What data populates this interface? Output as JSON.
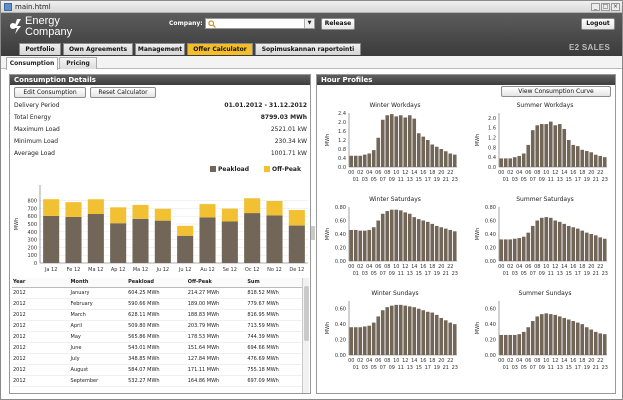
{
  "window": {
    "title": "main.html"
  },
  "header": {
    "logo_line1": "Energy",
    "logo_line2": "Company",
    "company_label": "Company:",
    "company_value": "",
    "release_label": "Release",
    "logout_label": "Logout",
    "product_name": "E2 SALES",
    "nav_tabs": [
      {
        "label": "Portfolio",
        "active": false
      },
      {
        "label": "Own Agreements",
        "active": false
      },
      {
        "label": "Management",
        "active": false
      },
      {
        "label": "Offer Calculator",
        "active": true
      },
      {
        "label": "Sopimuskannan raportointi",
        "active": false
      }
    ]
  },
  "subtabs": [
    {
      "label": "Consumption",
      "active": true
    },
    {
      "label": "Pricing",
      "active": false
    }
  ],
  "consumption": {
    "title": "Consumption Details",
    "edit_label": "Edit Consumption",
    "reset_label": "Reset Calculator",
    "info": [
      {
        "label": "Delivery Period",
        "value": "01.01.2012 - 31.12.2012"
      },
      {
        "label": "Total Energy",
        "value": "8799.03 MWh"
      },
      {
        "label": "Maximum Load",
        "value": "2521.01 kW"
      },
      {
        "label": "Minimum Load",
        "value": "230.34 kW"
      },
      {
        "label": "Average Load",
        "value": "1001.71 kW"
      }
    ],
    "legend": {
      "peak": "Peakload",
      "offpeak": "Off-Peak"
    },
    "table": {
      "columns": [
        "Year",
        "Month",
        "Peakload",
        "Off-Peak",
        "Sum"
      ],
      "rows": [
        [
          "2012",
          "January",
          "604.25 MWh",
          "214.27 MWh",
          "818.52 MWh"
        ],
        [
          "2012",
          "February",
          "590.66 MWh",
          "189.00 MWh",
          "779.67 MWh"
        ],
        [
          "2012",
          "March",
          "628.11 MWh",
          "188.83 MWh",
          "816.95 MWh"
        ],
        [
          "2012",
          "April",
          "509.80 MWh",
          "203.79 MWh",
          "713.59 MWh"
        ],
        [
          "2012",
          "May",
          "565.86 MWh",
          "178.53 MWh",
          "744.39 MWh"
        ],
        [
          "2012",
          "June",
          "543.01 MWh",
          "151.64 MWh",
          "694.66 MWh"
        ],
        [
          "2012",
          "July",
          "348.85 MWh",
          "127.84 MWh",
          "476.69 MWh"
        ],
        [
          "2012",
          "August",
          "584.07 MWh",
          "171.11 MWh",
          "755.18 MWh"
        ],
        [
          "2012",
          "September",
          "532.27 MWh",
          "164.86 MWh",
          "697.09 MWh"
        ]
      ]
    }
  },
  "hour_profiles": {
    "title": "Hour Profiles",
    "view_label": "View Consumption Curve"
  },
  "colors": {
    "peak": "#716658",
    "offpeak": "#f1c033",
    "accent": "#f3be29"
  },
  "chart_data": [
    {
      "type": "bar",
      "stacked": true,
      "title": "",
      "ylabel": "MWh",
      "categories": [
        "Ja 12",
        "Fe 12",
        "Ma 12",
        "Ap 12",
        "Ma 12",
        "Ju 12",
        "Ju 12",
        "Au 12",
        "Se 12",
        "Oc 12",
        "No 12",
        "De 12"
      ],
      "series": [
        {
          "name": "Peakload",
          "values": [
            604,
            591,
            628,
            510,
            566,
            543,
            349,
            584,
            532,
            640,
            610,
            480
          ]
        },
        {
          "name": "Off-Peak",
          "values": [
            214,
            189,
            189,
            204,
            179,
            152,
            128,
            171,
            165,
            190,
            185,
            200
          ]
        }
      ],
      "ylim": [
        0,
        1000
      ],
      "yticks": [
        0,
        100,
        200,
        300,
        400,
        500,
        600,
        700,
        800
      ]
    },
    {
      "type": "bar",
      "title": "Winter Workdays",
      "ylabel": "MWh",
      "x": [
        0,
        1,
        2,
        3,
        4,
        5,
        6,
        7,
        8,
        9,
        10,
        11,
        12,
        13,
        14,
        15,
        16,
        17,
        18,
        19,
        20,
        21,
        22,
        23
      ],
      "values": [
        0.5,
        0.5,
        0.5,
        0.55,
        0.6,
        0.75,
        1.3,
        2.1,
        2.3,
        2.35,
        2.25,
        2.3,
        2.2,
        2.3,
        2.15,
        1.5,
        1.35,
        1.2,
        1.0,
        0.9,
        0.8,
        0.7,
        0.6,
        0.55
      ],
      "ylim": [
        0,
        2.4
      ],
      "yticks": [
        0.0,
        0.4,
        0.8,
        1.2,
        1.6,
        2.0,
        2.4
      ]
    },
    {
      "type": "bar",
      "title": "Summer Workdays",
      "ylabel": "MWh",
      "x": [
        0,
        1,
        2,
        3,
        4,
        5,
        6,
        7,
        8,
        9,
        10,
        11,
        12,
        13,
        14,
        15,
        16,
        17,
        18,
        19,
        20,
        21,
        22,
        23
      ],
      "values": [
        0.35,
        0.35,
        0.35,
        0.4,
        0.45,
        0.55,
        0.9,
        1.5,
        1.7,
        1.75,
        1.75,
        1.85,
        1.7,
        1.75,
        1.55,
        1.1,
        0.9,
        0.85,
        0.7,
        0.65,
        0.6,
        0.5,
        0.45,
        0.4
      ],
      "ylim": [
        0,
        2.2
      ],
      "yticks": [
        0.0,
        0.4,
        0.8,
        1.2,
        1.6,
        2.0
      ]
    },
    {
      "type": "bar",
      "title": "Winter Saturdays",
      "ylabel": "MWh",
      "x": [
        0,
        1,
        2,
        3,
        4,
        5,
        6,
        7,
        8,
        9,
        10,
        11,
        12,
        13,
        14,
        15,
        16,
        17,
        18,
        19,
        20,
        21,
        22,
        23
      ],
      "values": [
        0.46,
        0.46,
        0.45,
        0.45,
        0.46,
        0.5,
        0.6,
        0.7,
        0.74,
        0.76,
        0.76,
        0.75,
        0.72,
        0.7,
        0.65,
        0.62,
        0.6,
        0.58,
        0.55,
        0.52,
        0.5,
        0.48,
        0.46,
        0.44
      ],
      "ylim": [
        0,
        0.8
      ],
      "yticks": [
        0.0,
        0.2,
        0.4,
        0.6,
        0.8
      ]
    },
    {
      "type": "bar",
      "title": "Summer Saturdays",
      "ylabel": "MWh",
      "x": [
        0,
        1,
        2,
        3,
        4,
        5,
        6,
        7,
        8,
        9,
        10,
        11,
        12,
        13,
        14,
        15,
        16,
        17,
        18,
        19,
        20,
        21,
        22,
        23
      ],
      "values": [
        0.32,
        0.32,
        0.32,
        0.33,
        0.34,
        0.36,
        0.42,
        0.52,
        0.6,
        0.64,
        0.65,
        0.64,
        0.6,
        0.58,
        0.55,
        0.52,
        0.5,
        0.48,
        0.45,
        0.42,
        0.4,
        0.38,
        0.35,
        0.33
      ],
      "ylim": [
        0,
        0.8
      ],
      "yticks": [
        0.0,
        0.2,
        0.4,
        0.6,
        0.8
      ]
    },
    {
      "type": "bar",
      "title": "Winter Sundays",
      "ylabel": "MWh",
      "x": [
        0,
        1,
        2,
        3,
        4,
        5,
        6,
        7,
        8,
        9,
        10,
        11,
        12,
        13,
        14,
        15,
        16,
        17,
        18,
        19,
        20,
        21,
        22,
        23
      ],
      "values": [
        0.36,
        0.36,
        0.36,
        0.37,
        0.38,
        0.42,
        0.5,
        0.58,
        0.62,
        0.64,
        0.65,
        0.65,
        0.64,
        0.63,
        0.62,
        0.6,
        0.58,
        0.56,
        0.55,
        0.52,
        0.48,
        0.45,
        0.42,
        0.4
      ],
      "ylim": [
        0,
        0.7
      ],
      "yticks": [
        0.0,
        0.2,
        0.4,
        0.6
      ]
    },
    {
      "type": "bar",
      "title": "Summer Sundays",
      "ylabel": "MWh",
      "x": [
        0,
        1,
        2,
        3,
        4,
        5,
        6,
        7,
        8,
        9,
        10,
        11,
        12,
        13,
        14,
        15,
        16,
        17,
        18,
        19,
        20,
        21,
        22,
        23
      ],
      "values": [
        0.26,
        0.26,
        0.26,
        0.26,
        0.27,
        0.3,
        0.36,
        0.44,
        0.5,
        0.53,
        0.54,
        0.53,
        0.52,
        0.5,
        0.48,
        0.46,
        0.44,
        0.42,
        0.4,
        0.36,
        0.33,
        0.3,
        0.28,
        0.27
      ],
      "ylim": [
        0,
        0.7
      ],
      "yticks": [
        0.0,
        0.2,
        0.4,
        0.6
      ]
    }
  ]
}
